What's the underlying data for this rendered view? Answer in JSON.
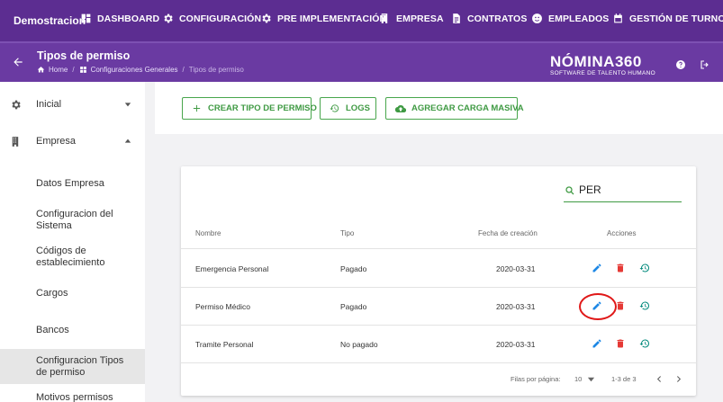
{
  "topnav": {
    "brand": "Demostracion",
    "items": [
      {
        "label": "DASHBOARD",
        "icon": "dashboard-icon"
      },
      {
        "label": "CONFIGURACIÓN",
        "icon": "gear-icon"
      },
      {
        "label": "PRE IMPLEMENTACIÓN",
        "icon": "gear-icon"
      },
      {
        "label": "EMPRESA",
        "icon": "building-icon"
      },
      {
        "label": "CONTRATOS",
        "icon": "document-icon"
      },
      {
        "label": "EMPLEADOS",
        "icon": "face-icon"
      },
      {
        "label": "GESTIÓN DE TURNOS",
        "icon": "calendar-icon"
      }
    ]
  },
  "header": {
    "title": "Tipos de permiso",
    "breadcrumb": [
      "Home",
      "Configuraciones Generales",
      "Tipos de permiso"
    ],
    "logo_main": "NÓMINA360",
    "logo_sub": "SOFTWARE DE TALENTO HUMANO"
  },
  "sidebar": {
    "inicial": "Inicial",
    "empresa": "Empresa",
    "subitems": [
      "Datos Empresa",
      "Configuracion del Sistema",
      "Códigos de establecimiento",
      "Cargos",
      "Bancos",
      "Configuracion Tipos de permiso",
      "Motivos permisos"
    ]
  },
  "actions": {
    "create": "CREAR TIPO DE PERMISO",
    "logs": "LOGS",
    "bulk": "AGREGAR CARGA MASIVA"
  },
  "table": {
    "search_value": "PER",
    "columns": [
      "Nombre",
      "Tipo",
      "Fecha de creación",
      "Acciones"
    ],
    "rows": [
      {
        "nombre": "Emergencia Personal",
        "tipo": "Pagado",
        "fecha": "2020-03-31"
      },
      {
        "nombre": "Permiso Médico",
        "tipo": "Pagado",
        "fecha": "2020-03-31"
      },
      {
        "nombre": "Tramite Personal",
        "tipo": "No pagado",
        "fecha": "2020-03-31"
      }
    ],
    "footer": {
      "rows_label": "Filas por página:",
      "rows_value": "10",
      "range": "1-3 de 3"
    }
  },
  "colors": {
    "nav": "#5c2d91",
    "header": "#6a3aa2",
    "accent": "#3f9a43",
    "edit": "#1e88e5",
    "delete": "#e53935",
    "history": "#00897b",
    "highlight": "#e01818"
  }
}
